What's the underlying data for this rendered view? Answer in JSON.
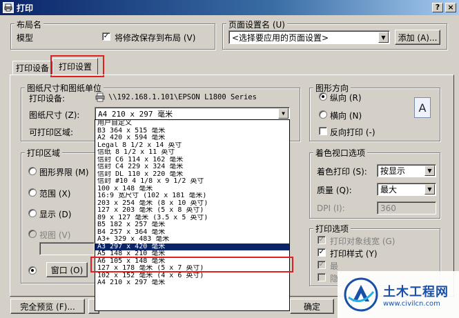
{
  "window": {
    "title": "打印",
    "help_btn": "?",
    "close_btn": "×"
  },
  "layout": {
    "group_title": "布局名",
    "name": "模型",
    "save_changes_label": "将修改保存到布局 (V)",
    "save_changes_checked": true
  },
  "page_setup": {
    "group_title": "页面设置名 (U)",
    "select_value": "<选择要应用的页面设置>",
    "add_button": "添加 (A)..."
  },
  "tabs": [
    {
      "label": "打印设备",
      "active": false
    },
    {
      "label": "打印设置",
      "active": true
    }
  ],
  "paper": {
    "group_title": "图纸尺寸和图纸单位",
    "device_label": "打印设备:",
    "device_value": "\\\\192.168.1.101\\EPSON L1800 Series",
    "size_label": "图纸尺寸 (Z):",
    "size_value": "A4 210 x 297 毫米",
    "printable_label": "可打印区域:"
  },
  "paper_size_options": [
    "用户自定义",
    "B3 364 x 515 毫米",
    "A2 420 x 594 毫米",
    "Legal 8 1/2 x 14 英寸",
    "信纸 8 1/2 x 11 英寸",
    "信封 C6  114 x 162 毫米",
    "信封 C4  229 x 324 毫米",
    "信封 DL  110 x 220 毫米",
    "信封 #10 4 1/8 x 9 1/2 英寸",
    "100 x 148 毫米",
    "16:9 宽尺寸 (102 x 181 毫米)",
    "203 x 254 毫米 (8 x 10 英寸)",
    "127 x 203 毫米 (5 x 8 英寸)",
    "89 x 127 毫米 (3.5 x 5 英寸)",
    "B5 182 x 257 毫米",
    "B4 257 x 364 毫米",
    "A3+ 329 x 483 毫米",
    "A3 297 x 420 毫米",
    "A5 148 x 210 毫米",
    "A6 105 x 148 毫米",
    "127 x 178 毫米 (5 x 7 英寸)",
    "102 x 152 毫米 (4 x 6 英寸)",
    "A4 210 x 297 毫米"
  ],
  "paper_size_selected_index": 17,
  "print_area": {
    "group_title": "打印区域",
    "options": [
      "图形界限 (M)",
      "范围 (X)",
      "显示 (D)",
      "视图 (V)",
      "窗口 (O)"
    ],
    "window_button": "窗口 (O)"
  },
  "orientation": {
    "group_title": "图形方向",
    "portrait": "纵向 (R)",
    "landscape": "横向 (N)",
    "reverse": "反向打印 (-)",
    "preview_letter": "A"
  },
  "shade_viewport": {
    "group_title": "着色视口选项",
    "shade_label": "着色打印 (S):",
    "shade_value": "按显示",
    "quality_label": "质量 (Q):",
    "quality_value": "最大",
    "dpi_label": "DPI (I):",
    "dpi_value": "360"
  },
  "plot_options": {
    "group_title": "打印选项",
    "items": [
      {
        "label": "打印对象线宽 (G)",
        "checked": true,
        "enabled": false
      },
      {
        "label": "打印样式 (Y)",
        "checked": true,
        "enabled": true
      },
      {
        "label": "最",
        "checked": true,
        "enabled": false
      },
      {
        "label": "隐",
        "checked": false,
        "enabled": false
      }
    ]
  },
  "footer": {
    "full_preview": "完全预览 (F)...",
    "ok": "确定"
  },
  "watermark": {
    "brand": "土木工程网",
    "url": "www.civilcn.com"
  },
  "colors": {
    "title_start": "#0a246a",
    "title_end": "#a6caf0",
    "face": "#d4d0c8",
    "highlight_red": "#e02020",
    "selection": "#0a246a",
    "brand_blue": "#1a4fa8"
  }
}
